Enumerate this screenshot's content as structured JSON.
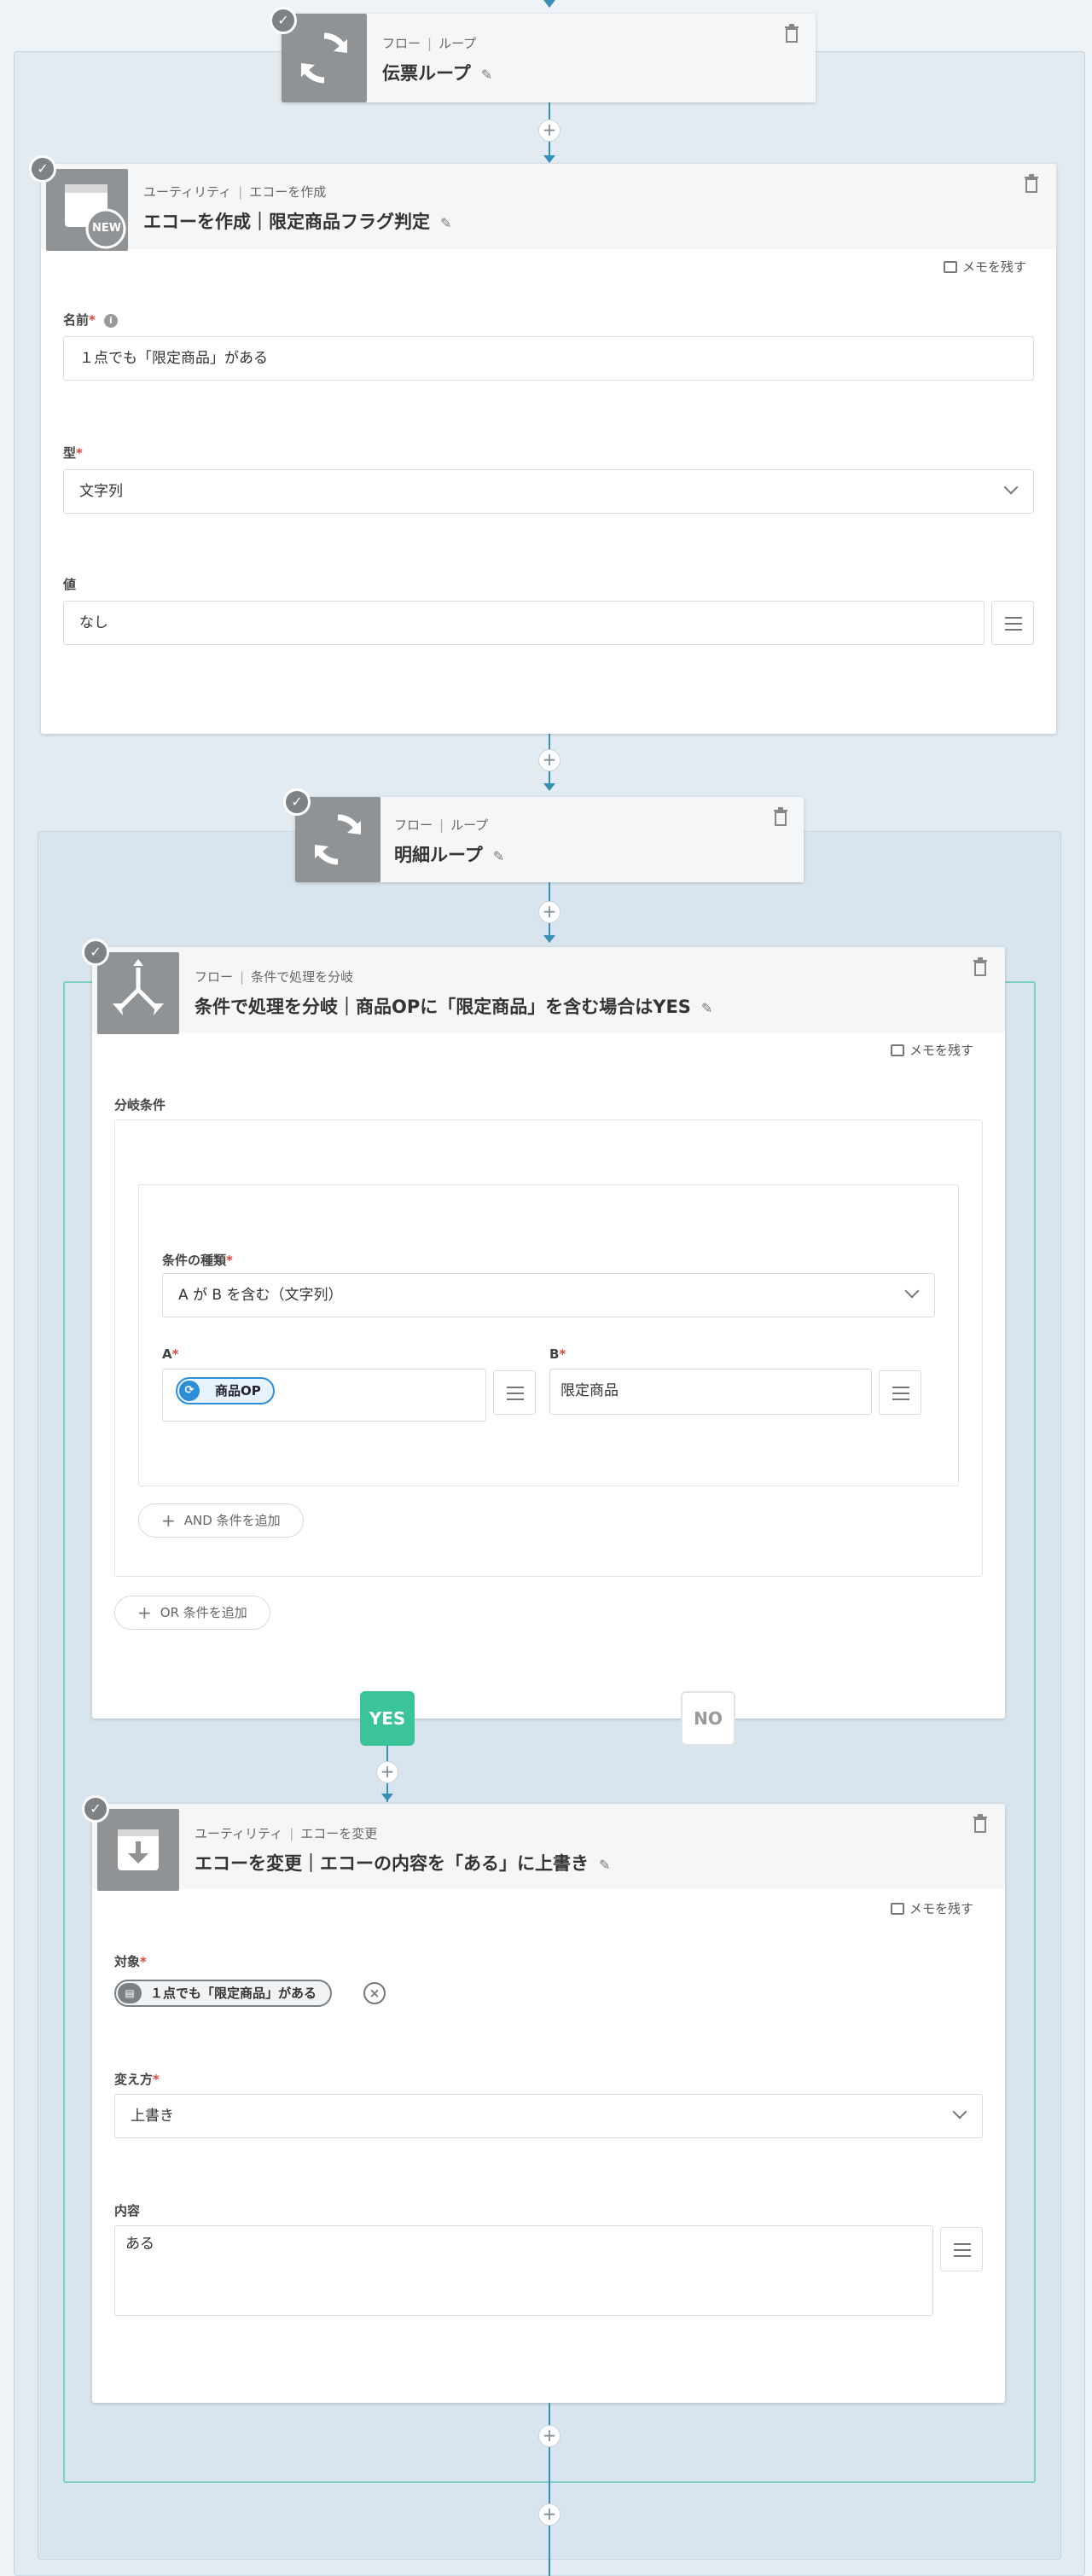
{
  "loop1": {
    "category": "フロー",
    "type": "ループ",
    "title": "伝票ループ"
  },
  "echo_create": {
    "category": "ユーティリティ",
    "type": "エコーを作成",
    "title": "エコーを作成｜限定商品フラグ判定",
    "memo": "メモを残す",
    "name_label": "名前",
    "name_value": "１点でも「限定商品」がある",
    "type_label": "型",
    "type_value": "文字列",
    "value_label": "値",
    "value_value": "なし",
    "icon_badge": "NEW"
  },
  "loop2": {
    "category": "フロー",
    "type": "ループ",
    "title": "明細ループ"
  },
  "branch": {
    "category": "フロー",
    "type": "条件で処理を分岐",
    "title": "条件で処理を分岐｜商品OPに「限定商品」を含む場合はYES",
    "memo": "メモを残す",
    "conditions_label": "分岐条件",
    "cond_type_label": "条件の種類",
    "cond_type_value": "A が B を含む（文字列）",
    "a_label": "A",
    "a_value": "商品OP",
    "b_label": "B",
    "b_value": "限定商品",
    "add_and": "AND 条件を追加",
    "add_or": "OR 条件を追加",
    "yes": "YES",
    "no": "NO"
  },
  "echo_change": {
    "category": "ユーティリティ",
    "type": "エコーを変更",
    "title": "エコーを変更｜エコーの内容を「ある」に上書き",
    "memo": "メモを残す",
    "target_label": "対象",
    "target_value": "１点でも「限定商品」がある",
    "method_label": "変え方",
    "method_value": "上書き",
    "content_label": "内容",
    "content_value": "ある"
  },
  "colors": {
    "accent": "#3a8fb7",
    "yes": "#3bc49a",
    "required": "#e0453a",
    "pill": "#2b8ed6"
  },
  "icons": [
    "loop-icon",
    "echo-create-icon",
    "branch-icon",
    "echo-change-icon",
    "trash-icon",
    "pencil-icon",
    "memo-icon",
    "check-icon",
    "plus-icon",
    "list-icon",
    "chevron-down-icon"
  ]
}
